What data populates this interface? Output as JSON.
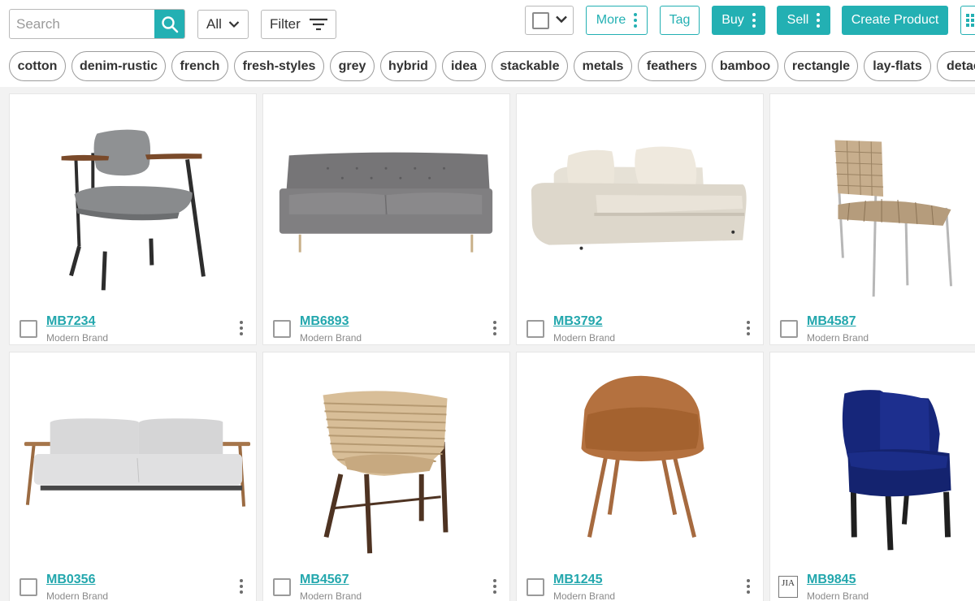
{
  "toolbar": {
    "search_placeholder": "Search",
    "scope_select": "All",
    "filter_label": "Filter",
    "more_label": "More",
    "tag_label": "Tag",
    "buy_label": "Buy",
    "sell_label": "Sell",
    "create_label": "Create Product",
    "accent_color": "#23b0b3"
  },
  "tags": [
    "cotton",
    "denim-rustic",
    "french",
    "fresh-styles",
    "grey",
    "hybrid",
    "idea",
    "stackable",
    "metals",
    "feathers",
    "bamboo",
    "rectangle",
    "lay-flats",
    "detac"
  ],
  "products": [
    {
      "code": "MB7234",
      "brand": "Modern Brand",
      "image": "grey-armchair"
    },
    {
      "code": "MB6893",
      "brand": "Modern Brand",
      "image": "grey-tufted-sofa"
    },
    {
      "code": "MB3792",
      "brand": "Modern Brand",
      "image": "cream-sectional"
    },
    {
      "code": "MB4587",
      "brand": "Modern Brand",
      "image": "woven-leather-chair"
    },
    {
      "code": "MB0356",
      "brand": "Modern Brand",
      "image": "light-grey-sofa"
    },
    {
      "code": "MB4567",
      "brand": "Modern Brand",
      "image": "rattan-barrel-chair"
    },
    {
      "code": "MB1245",
      "brand": "Modern Brand",
      "image": "tan-shell-chair"
    },
    {
      "code": "MB9845",
      "brand": "Modern Brand",
      "image": "navy-wingback-chair",
      "brand_logo": "JIA"
    }
  ]
}
